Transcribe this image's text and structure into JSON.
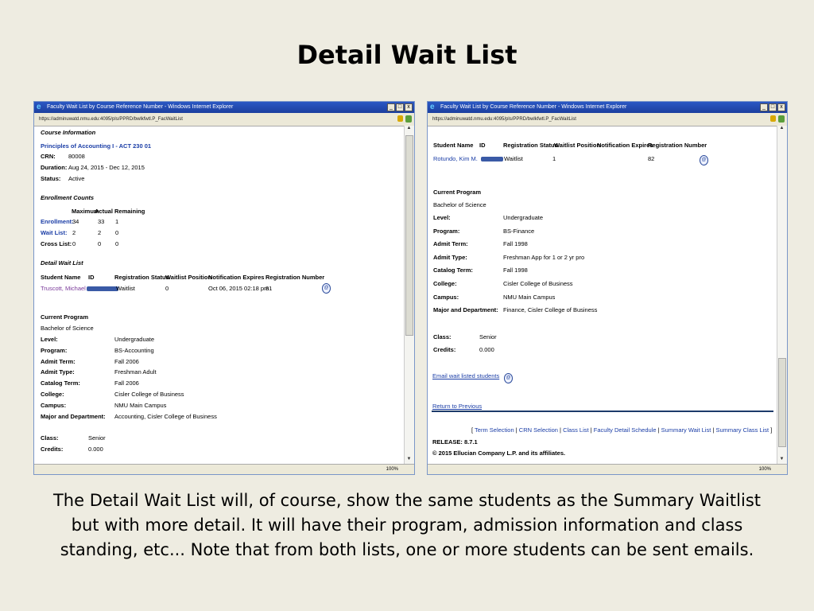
{
  "slide": {
    "title": "Detail Wait List",
    "caption": "The Detail Wait List will, of course, show the same students as the Summary Waitlist but with more detail.  It will have their program, admission information and class standing, etc...  Note that from both lists, one or more students can be sent emails."
  },
  "browser": {
    "window_title": "Faculty Wait List by Course Reference Number - Windows Internet Explorer",
    "url": "https://adminuwatd.nmu.edu:4095/pls/PPRD/bwlkfwtl.P_FacWaitList",
    "zoom": "100%"
  },
  "left": {
    "course_info_heading": "Course Information",
    "course_title": "Principles of Accounting I - ACT 230 01",
    "crn_label": "CRN:",
    "crn_value": "80008",
    "duration_label": "Duration:",
    "duration_value": "Aug 24, 2015 - Dec 12, 2015",
    "status_label": "Status:",
    "status_value": "Active",
    "enrollment_heading": "Enrollment Counts",
    "enrollment_cols": [
      "Maximum",
      "Actual",
      "Remaining"
    ],
    "enrollment_rows": [
      {
        "label": "Enrollment:",
        "max": "34",
        "actual": "33",
        "remaining": "1"
      },
      {
        "label": "Wait List:",
        "max": "2",
        "actual": "2",
        "remaining": "0"
      },
      {
        "label": "Cross List:",
        "max": "0",
        "actual": "0",
        "remaining": "0"
      }
    ],
    "waitlist_heading": "Detail Wait List",
    "table_headers": [
      "Student Name",
      "ID",
      "Registration Status",
      "Waitlist Position",
      "Notification Expires",
      "Registration Number"
    ],
    "student": {
      "name": "Truscott, Michael D.",
      "status": "Waitlist",
      "position": "0",
      "expires": "Oct 06, 2015 02:18 pm",
      "reg_number": "81"
    },
    "program_heading": "Current Program",
    "program_degree": "Bachelor of Science",
    "details": [
      {
        "label": "Level:",
        "value": "Undergraduate"
      },
      {
        "label": "Program:",
        "value": "BS-Accounting"
      },
      {
        "label": "Admit Term:",
        "value": "Fall 2006"
      },
      {
        "label": "Admit Type:",
        "value": "Freshman Adult"
      },
      {
        "label": "Catalog Term:",
        "value": "Fall 2006"
      },
      {
        "label": "College:",
        "value": "Cisler College of Business"
      },
      {
        "label": "Campus:",
        "value": "NMU Main Campus"
      },
      {
        "label": "Major and Department:",
        "value": "Accounting, Cisler College of Business"
      }
    ],
    "class_label": "Class:",
    "class_value": "Senior",
    "credits_label": "Credits:",
    "credits_value": "0.000"
  },
  "right": {
    "table_headers": [
      "Student Name",
      "ID",
      "Registration Status",
      "Waitlist Position",
      "Notification Expires",
      "Registration Number"
    ],
    "student": {
      "name": "Rotundo, Kim M.",
      "status": "Waitlist",
      "position": "1",
      "reg_number": "82"
    },
    "program_heading": "Current Program",
    "program_degree": "Bachelor of Science",
    "details": [
      {
        "label": "Level:",
        "value": "Undergraduate"
      },
      {
        "label": "Program:",
        "value": "BS-Finance"
      },
      {
        "label": "Admit Term:",
        "value": "Fall 1998"
      },
      {
        "label": "Admit Type:",
        "value": "Freshman App for 1 or 2 yr pro"
      },
      {
        "label": "Catalog Term:",
        "value": "Fall 1998"
      },
      {
        "label": "College:",
        "value": "Cisler College of Business"
      },
      {
        "label": "Campus:",
        "value": "NMU Main Campus"
      },
      {
        "label": "Major and Department:",
        "value": "Finance, Cisler College of Business"
      }
    ],
    "class_label": "Class:",
    "class_value": "Senior",
    "credits_label": "Credits:",
    "credits_value": "0.000",
    "email_link": "Email wait listed students",
    "return_link": "Return to Previous",
    "footer_links": [
      "Term Selection",
      "CRN Selection",
      "Class List",
      "Faculty Detail Schedule",
      "Summary Wait List",
      "Summary Class List"
    ],
    "release": "RELEASE: 8.7.1",
    "copyright": "© 2015 Ellucian Company L.P. and its affiliates."
  }
}
